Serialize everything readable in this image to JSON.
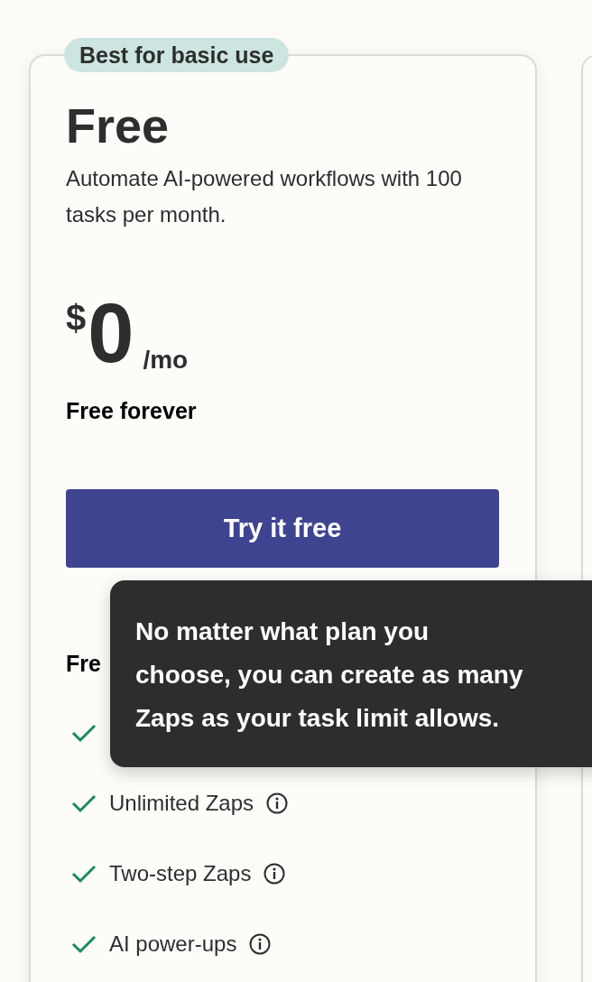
{
  "plan": {
    "badge": "Best for basic use",
    "name": "Free",
    "description": "Automate AI-powered workflows with 100 tasks per month.",
    "price": {
      "currency": "$",
      "amount": "0",
      "period": "/mo"
    },
    "price_note": "Free forever",
    "cta": "Try it free",
    "features_heading": "Fre",
    "features": [
      {
        "checked": true
      },
      {
        "checked": true,
        "label": "Unlimited Zaps",
        "info": true
      },
      {
        "checked": true,
        "label": "Two-step Zaps",
        "info": true
      },
      {
        "checked": true,
        "label": "AI power-ups",
        "info": true
      }
    ]
  },
  "tooltip": {
    "text": "No matter what plan you\nchoose, you can create as many\nZaps as your task limit allows."
  }
}
